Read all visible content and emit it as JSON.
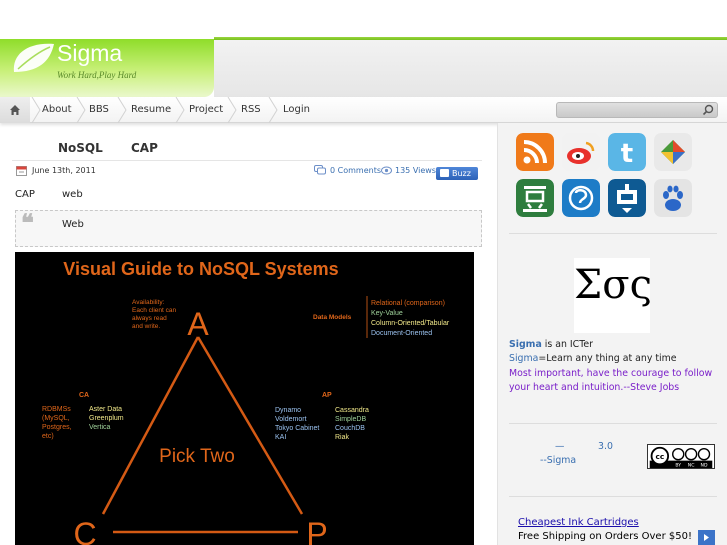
{
  "header": {
    "title": "Sigma",
    "tagline": "Work Hard,Play Hard"
  },
  "nav": {
    "items": [
      "About",
      "BBS",
      "Resume",
      "Project",
      "RSS",
      "Login"
    ]
  },
  "search": {
    "placeholder": ""
  },
  "post": {
    "title_parts": [
      "NoSQL",
      "CAP"
    ],
    "date": "June 13th, 2011",
    "comments": "0 Comments",
    "views": "135 Views",
    "buzz": "Buzz",
    "body_words": [
      "CAP",
      "web"
    ],
    "quote": "Web"
  },
  "figure": {
    "title": "Visual Guide to NoSQL Systems",
    "availability": [
      "Availability:",
      "Each client can",
      "always read",
      "and write."
    ],
    "data_models_label": "Data Models",
    "data_models": [
      "Relational (comparison)",
      "Key-Value",
      "Column-Oriented/Tabular",
      "Document-Oriented"
    ],
    "ca_label": "CA",
    "ca_left": [
      "RDBMSs",
      "(MySQL,",
      "Postgres,",
      "etc)"
    ],
    "ca_right": [
      "Aster Data",
      "Greenplum",
      "Vertica"
    ],
    "ap_label": "AP",
    "ap_left": [
      "Dynamo",
      "Voldemort",
      "Tokyo Cabinet",
      "KAI"
    ],
    "ap_right": [
      "Cassandra",
      "SimpleDB",
      "CouchDB",
      "Riak"
    ],
    "center": "Pick Two",
    "vertices": [
      "A",
      "C",
      "P"
    ]
  },
  "sidebar": {
    "icons": [
      "rss-icon",
      "weibo-icon",
      "twitter-icon",
      "google-reader-icon",
      "douban-icon",
      "qq-icon",
      "xianguo-icon",
      "baidu-icon"
    ],
    "sigma_symbol": "Σσς",
    "bio_name": "Sigma",
    "bio_line1": " is an ICTer",
    "bio_line2_name": "Sigma",
    "bio_line2": "=Learn any thing at any time",
    "bio_quote": "Most important, have the courage to follow your heart and intuition.--Steve Jobs",
    "license_dash": "—",
    "license_version": "3.0",
    "license_by": "--Sigma",
    "ad_link": "Cheapest Ink Cartridges",
    "ad_text": "Free Shipping on Orders Over $50!"
  },
  "colors": {
    "accent_green": "#8fdd2a",
    "link_blue": "#3a6fb0",
    "purple_quote": "#7a1fc9"
  }
}
